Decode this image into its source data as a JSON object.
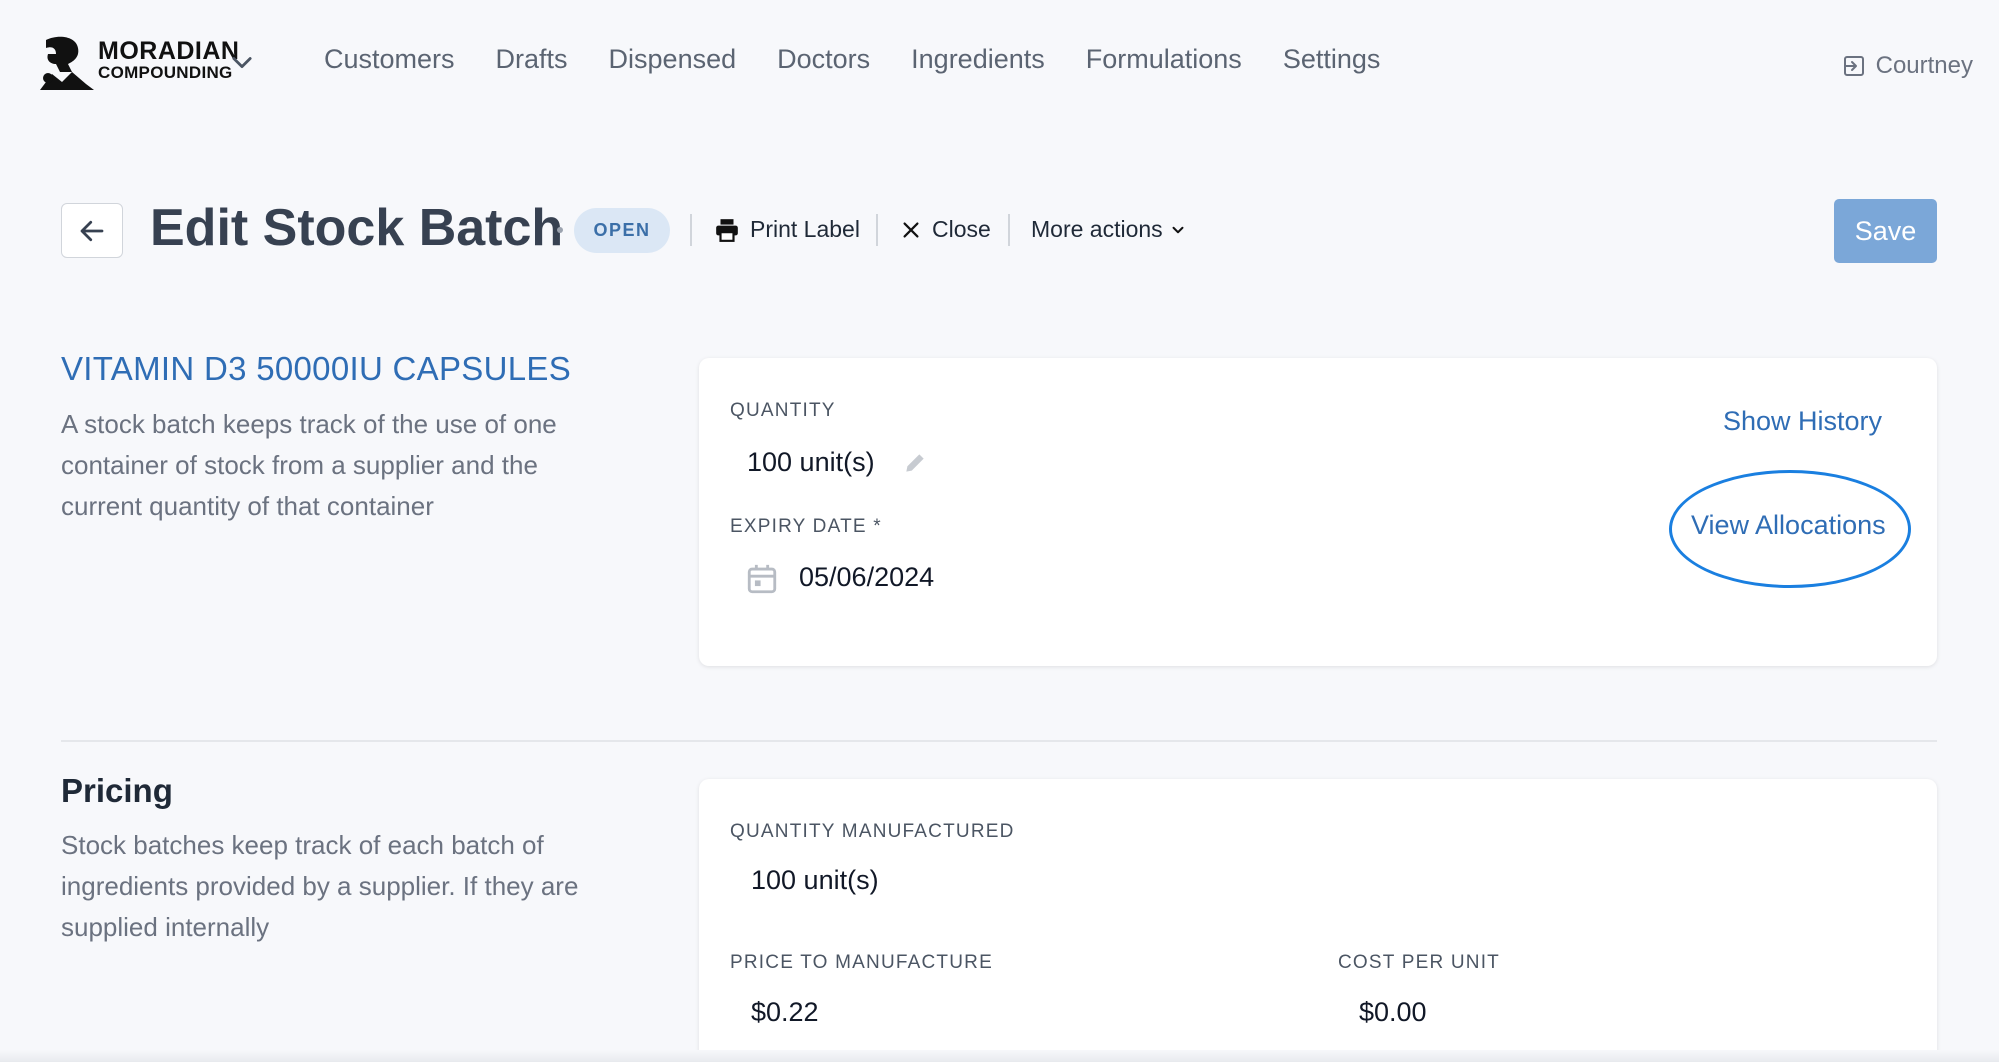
{
  "brand": {
    "line1": "MORADIAN",
    "line2": "COMPOUNDING"
  },
  "nav": {
    "items": [
      {
        "label": "Customers"
      },
      {
        "label": "Drafts"
      },
      {
        "label": "Dispensed"
      },
      {
        "label": "Doctors"
      },
      {
        "label": "Ingredients"
      },
      {
        "label": "Formulations"
      },
      {
        "label": "Settings"
      }
    ]
  },
  "user": {
    "name": "Courtney",
    "icon": "logout-icon"
  },
  "header": {
    "title": "Edit Stock Batch",
    "status": "OPEN",
    "print_label": "Print Label",
    "close_label": "Close",
    "more_actions": "More actions",
    "save_label": "Save"
  },
  "batch_section": {
    "heading": "VITAMIN D3 50000IU CAPSULES",
    "description": "A stock batch keeps track of the use of one container of stock from a supplier and the current quantity of that container",
    "quantity_label": "QUANTITY",
    "quantity_value": "100 unit(s)",
    "expiry_label": "EXPIRY DATE *",
    "expiry_value": "05/06/2024",
    "show_history": "Show History",
    "view_allocations": "View Allocations"
  },
  "pricing_section": {
    "heading": "Pricing",
    "description": "Stock batches keep track of each batch of ingredients provided by a supplier. If they are supplied internally",
    "qty_manufactured_label": "QUANTITY MANUFACTURED",
    "qty_manufactured_value": "100 unit(s)",
    "price_label": "PRICE TO MANUFACTURE",
    "price_value": "$0.22",
    "cost_label": "COST PER UNIT",
    "cost_value": "$0.00"
  },
  "colors": {
    "accent": "#2f6db5",
    "save_button": "#7ba7d8",
    "badge_bg": "#dbe7f5",
    "highlight_ellipse": "#1a7fe0"
  }
}
